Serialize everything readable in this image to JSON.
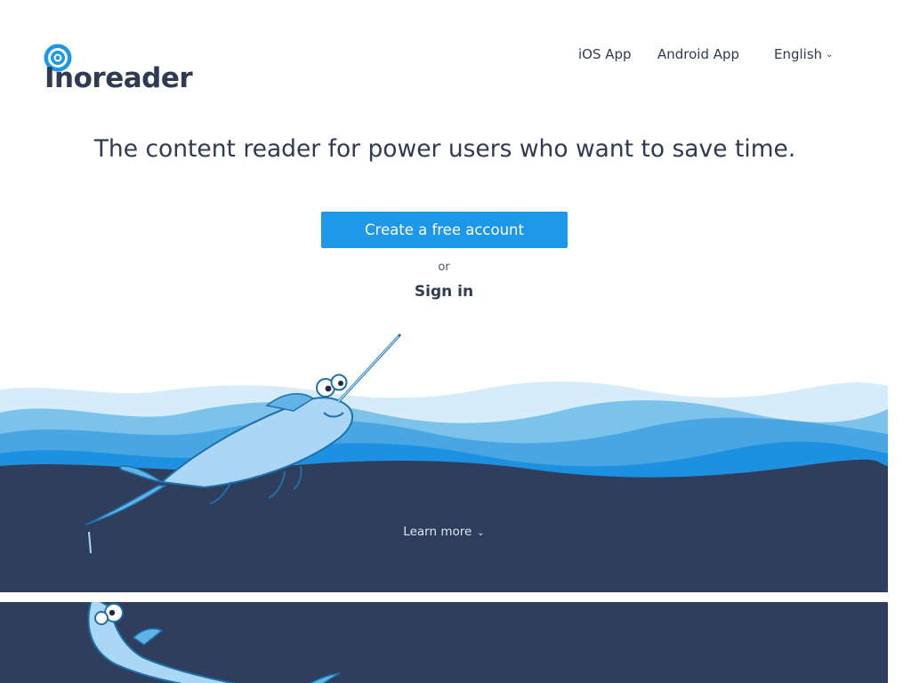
{
  "brand": {
    "name": "Inoreader"
  },
  "nav": {
    "ios": "iOS App",
    "android": "Android App",
    "language": "English"
  },
  "hero": {
    "tagline": "The content reader for power users who want to save time.",
    "cta_label": "Create a free account",
    "or_label": "or",
    "signin_label": "Sign in"
  },
  "footer": {
    "learn_more": "Learn more"
  },
  "colors": {
    "brand_blue": "#1c97ea",
    "navy": "#2f3b52",
    "sea_dark": "#2e3e5c",
    "wave_light": "#d6ecfa",
    "wave_mid": "#5fb3e6",
    "wave_deep": "#1e90e0"
  },
  "icons": {
    "logo": "inoreader-logo-icon",
    "language_chevron": "chevron-down-icon",
    "learn_chevron": "chevron-down-icon"
  }
}
